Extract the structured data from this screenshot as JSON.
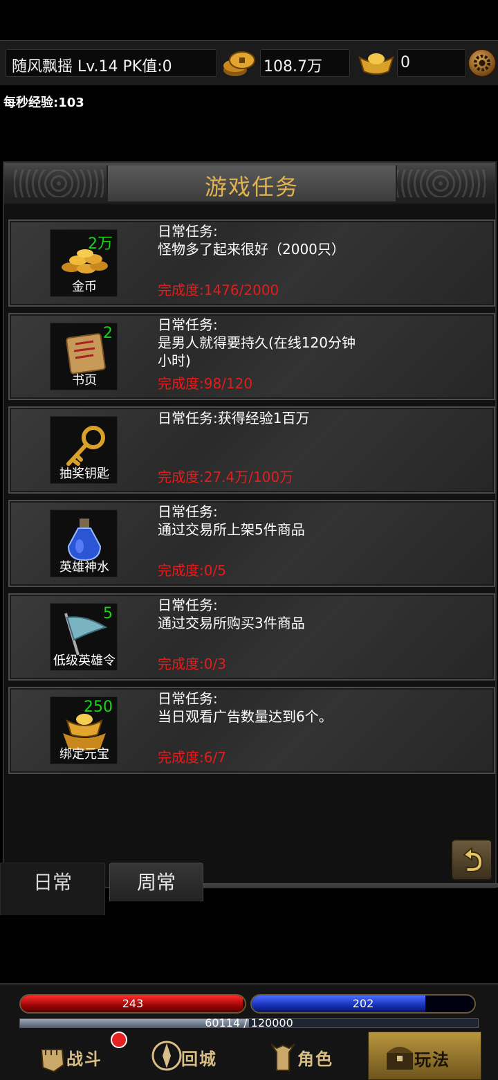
{
  "topbar": {
    "player_info": "随风飘摇  Lv.14 PK值:0",
    "gold": "108.7万",
    "ingot": "0"
  },
  "exp_rate": "每秒经验:103",
  "panel": {
    "title": "游戏任务",
    "tasks": [
      {
        "reward_count": "2万",
        "reward_name": "金币",
        "desc": "日常任务:\n怪物多了起来很好（2000只）",
        "progress": "完成度:1476/2000",
        "icon": "gold-coins-icon"
      },
      {
        "reward_count": "2",
        "reward_name": "书页",
        "desc": "日常任务:\n是男人就得要持久(在线120分钟小时)",
        "progress": "完成度:98/120",
        "icon": "scroll-icon"
      },
      {
        "reward_count": "",
        "reward_name": "抽奖钥匙",
        "desc": "日常任务:获得经验1百万",
        "progress": "完成度:27.4万/100万",
        "icon": "key-icon"
      },
      {
        "reward_count": "",
        "reward_name": "英雄神水",
        "desc": "日常任务:\n通过交易所上架5件商品",
        "progress": "完成度:0/5",
        "icon": "potion-icon"
      },
      {
        "reward_count": "5",
        "reward_name": "低级英雄令",
        "desc": "日常任务:\n通过交易所购买3件商品",
        "progress": "完成度:0/3",
        "icon": "flag-icon"
      },
      {
        "reward_count": "250",
        "reward_name": "绑定元宝",
        "desc": "日常任务:\n当日观看广告数量达到6个。",
        "progress": "完成度:6/7",
        "icon": "ingot-icon"
      }
    ]
  },
  "tabs": {
    "daily": "日常",
    "weekly": "周常"
  },
  "status": {
    "hp": "243",
    "hp_fraction": 0.99,
    "mp": "202",
    "mp_fraction": 0.78,
    "exp": "60114 / 120000",
    "exp_fraction": 0.5
  },
  "nav": {
    "battle": "战斗",
    "town": "回城",
    "role": "角色",
    "play": "玩法"
  },
  "colors": {
    "accent_gold": "#e0b351",
    "progress_red": "#e51c1c",
    "count_green": "#16d416"
  }
}
